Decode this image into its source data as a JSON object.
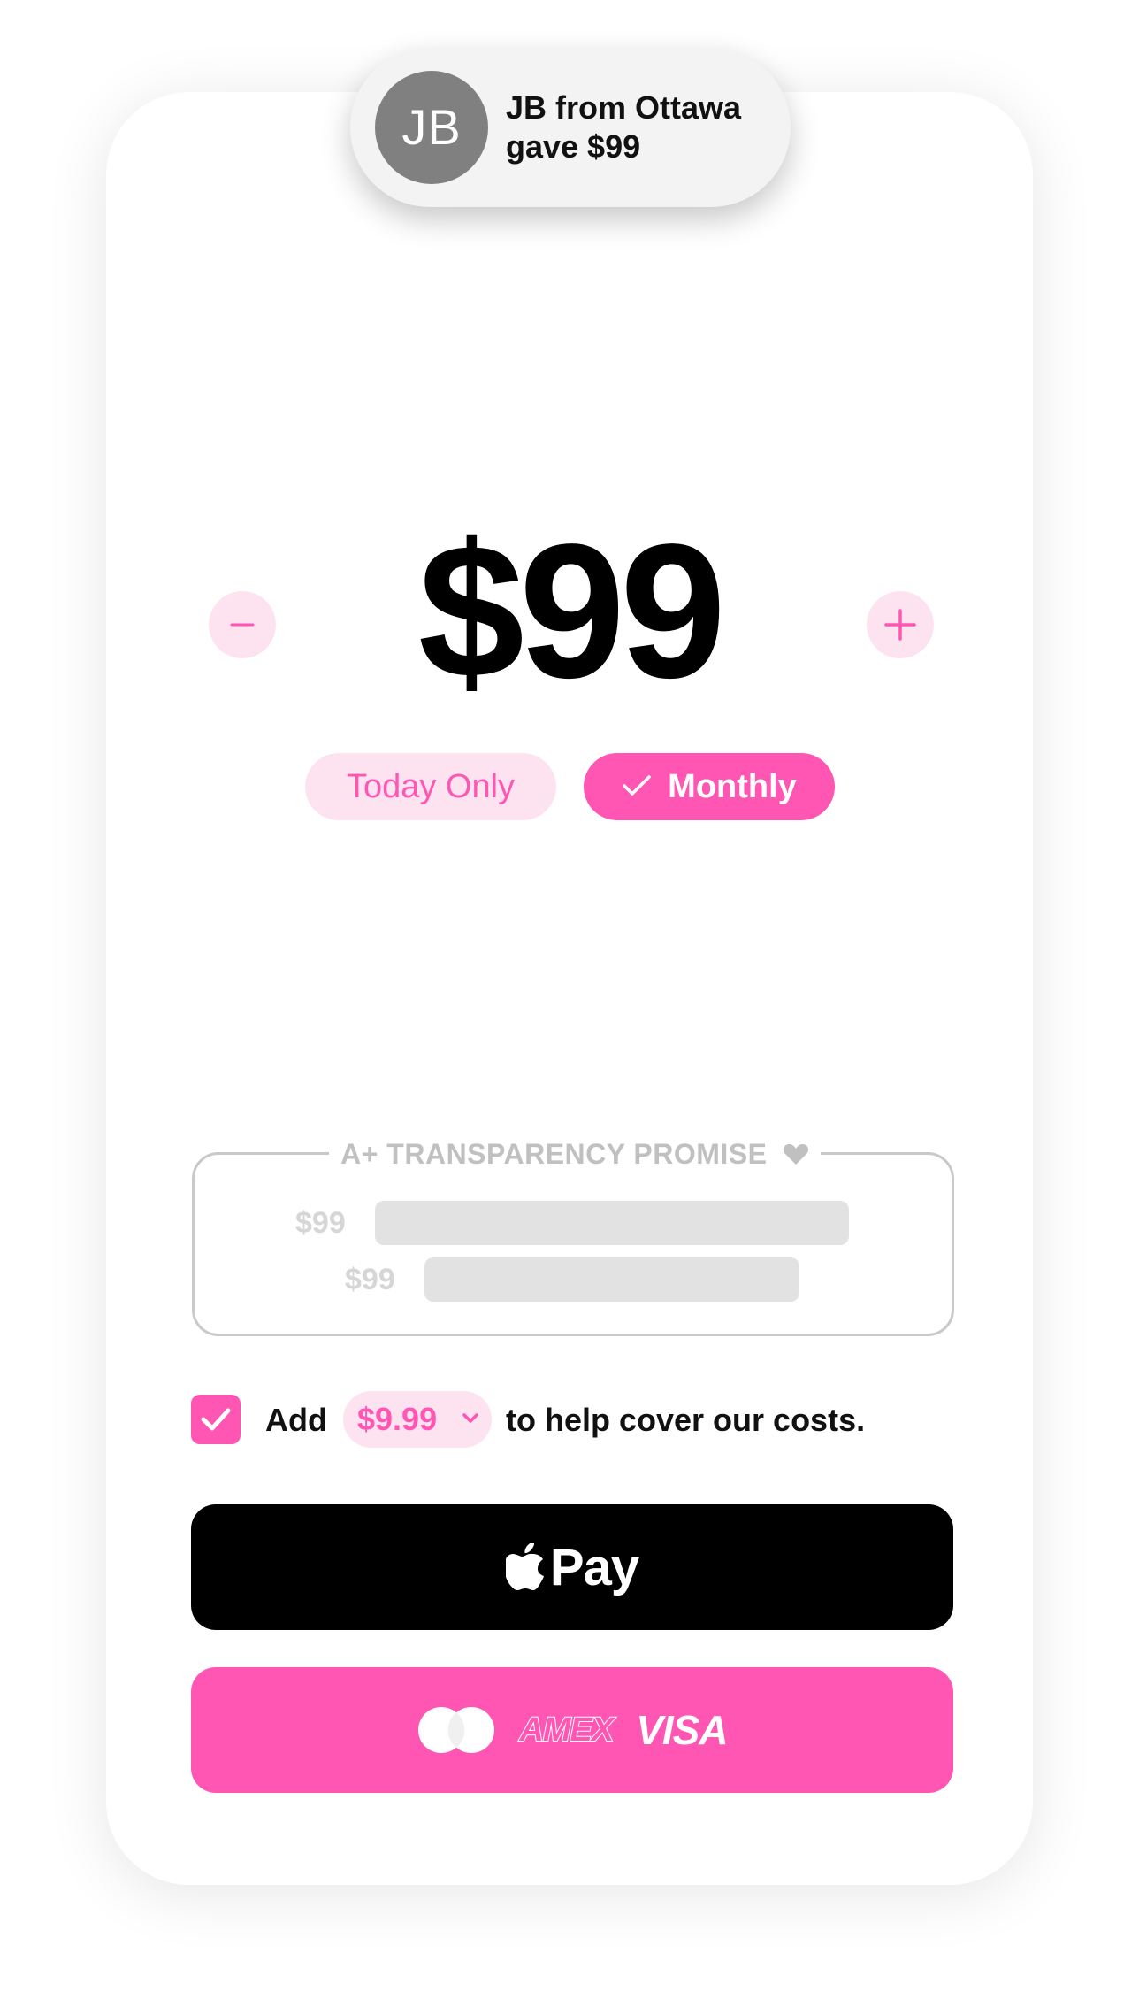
{
  "toast": {
    "avatar_initials": "JB",
    "message": "JB from Ottawa gave $99"
  },
  "donation": {
    "amount": "$99",
    "decrease_icon": "minus-icon",
    "increase_icon": "plus-icon"
  },
  "frequency": {
    "options": [
      "Today Only",
      "Monthly"
    ],
    "selected": "Monthly"
  },
  "transparency": {
    "title": "A+ TRANSPARENCY PROMISE",
    "title_icon": "heart-icon",
    "rows": [
      {
        "amount": "$99"
      },
      {
        "amount": "$99"
      }
    ]
  },
  "cover_costs": {
    "checked": true,
    "prefix": "Add",
    "fee_value": "$9.99",
    "suffix": "to help cover our costs."
  },
  "payment": {
    "apple_pay_label": "Pay",
    "card_brands": [
      "mastercard",
      "AMEX",
      "VISA"
    ]
  },
  "colors": {
    "accent": "#ff56b3",
    "accent_light": "#fde3f0",
    "avatar_bg": "#808080",
    "muted": "#c0c0c0"
  }
}
